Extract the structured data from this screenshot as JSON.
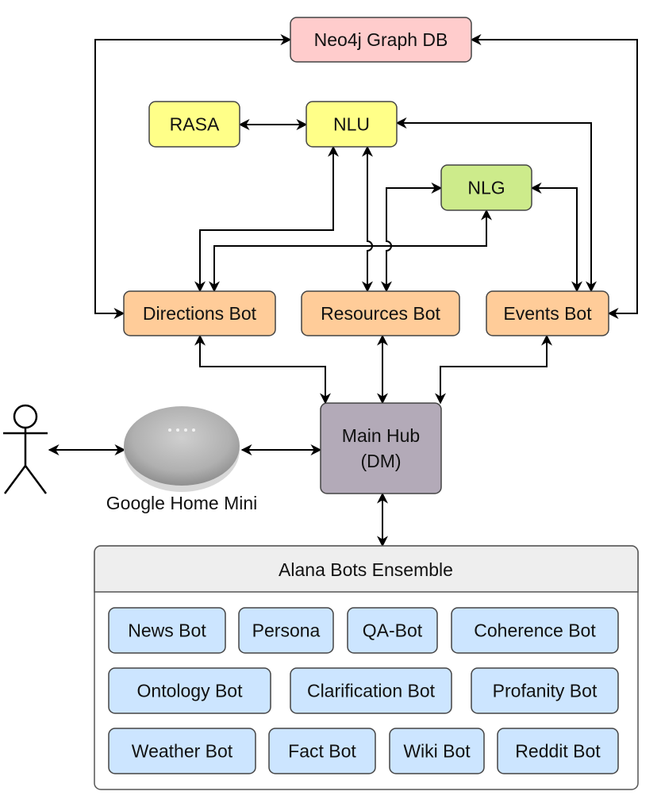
{
  "nodes": {
    "neo4j": {
      "label": "Neo4j Graph DB",
      "color": "#ffcccc"
    },
    "rasa": {
      "label": "RASA",
      "color": "#ffff88"
    },
    "nlu": {
      "label": "NLU",
      "color": "#ffff88"
    },
    "nlg": {
      "label": "NLG",
      "color": "#cdeb8b"
    },
    "directions": {
      "label": "Directions Bot",
      "color": "#ffcc99"
    },
    "resources": {
      "label": "Resources Bot",
      "color": "#ffcc99"
    },
    "events": {
      "label": "Events Bot",
      "color": "#ffcc99"
    },
    "hub": {
      "label": "Main Hub",
      "label2": "(DM)",
      "color": "#b3aab8"
    }
  },
  "google_home": {
    "label": "Google Home Mini"
  },
  "ensemble": {
    "title": "Alana Bots Ensemble",
    "header_color": "#eeeeee",
    "bot_color": "#cce5ff",
    "bots": [
      "News Bot",
      "Persona",
      "QA-Bot",
      "Coherence Bot",
      "Ontology Bot",
      "Clarification Bot",
      "Profanity Bot",
      "Weather Bot",
      "Fact Bot",
      "Wiki Bot",
      "Reddit Bot"
    ]
  }
}
